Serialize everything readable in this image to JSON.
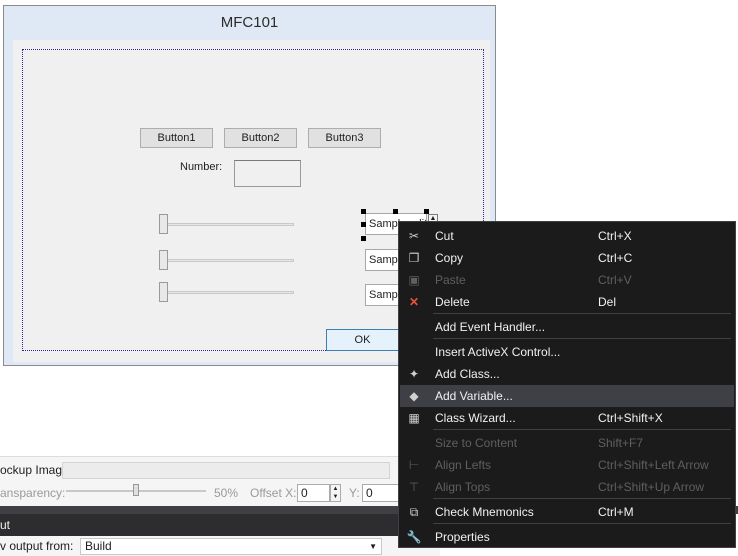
{
  "dialog": {
    "title": "MFC101",
    "buttons": [
      "Button1",
      "Button2",
      "Button3"
    ],
    "number_label": "Number:",
    "sample_edit_1": "Sample edit",
    "sample_edit_2": "Sample",
    "sample_edit_3": "Sample",
    "ok_label": "OK"
  },
  "properties_panel": {
    "mockup_label": "ockup Image:",
    "transparency_label": "ansparency:",
    "opacity_percent": "50%",
    "offset_x_label": "Offset X:",
    "offset_x_value": "0",
    "offset_y_label": "Y:",
    "offset_y_value": "0"
  },
  "output_panel": {
    "title": "ut",
    "show_output_label": "v output from:",
    "show_output_value": "Build"
  },
  "context_menu": {
    "items": [
      {
        "label": "Cut",
        "shortcut": "Ctrl+X",
        "icon": "scissors-icon",
        "glyph": "✂",
        "enabled": true
      },
      {
        "label": "Copy",
        "shortcut": "Ctrl+C",
        "icon": "copy-icon",
        "glyph": "❐",
        "enabled": true
      },
      {
        "label": "Paste",
        "shortcut": "Ctrl+V",
        "icon": "paste-icon",
        "glyph": "▣",
        "enabled": false
      },
      {
        "label": "Delete",
        "shortcut": "Del",
        "icon": "delete-icon",
        "glyph": "✕",
        "enabled": true
      },
      {
        "label": "Add Event Handler...",
        "shortcut": "",
        "icon": "",
        "glyph": "",
        "enabled": true
      },
      {
        "label": "Insert ActiveX Control...",
        "shortcut": "",
        "icon": "",
        "glyph": "",
        "enabled": true
      },
      {
        "label": "Add Class...",
        "shortcut": "",
        "icon": "add-class-icon",
        "glyph": "✦",
        "enabled": true
      },
      {
        "label": "Add Variable...",
        "shortcut": "",
        "icon": "add-variable-icon",
        "glyph": "◆",
        "enabled": true
      },
      {
        "label": "Class Wizard...",
        "shortcut": "Ctrl+Shift+X",
        "icon": "class-wizard-icon",
        "glyph": "▦",
        "enabled": true
      },
      {
        "label": "Size to Content",
        "shortcut": "Shift+F7",
        "icon": "",
        "glyph": "",
        "enabled": false
      },
      {
        "label": "Align Lefts",
        "shortcut": "Ctrl+Shift+Left Arrow",
        "icon": "align-lefts-icon",
        "glyph": "⊢",
        "enabled": false
      },
      {
        "label": "Align Tops",
        "shortcut": "Ctrl+Shift+Up Arrow",
        "icon": "align-tops-icon",
        "glyph": "⊤",
        "enabled": false
      },
      {
        "label": "Check Mnemonics",
        "shortcut": "Ctrl+M",
        "icon": "check-mnemonics-icon",
        "glyph": "⧉",
        "enabled": true
      },
      {
        "label": "Properties",
        "shortcut": "",
        "icon": "wrench-icon",
        "glyph": "🔧",
        "enabled": true
      }
    ],
    "highlighted": "Add Variable...",
    "delete_icon_color": "#e8533e"
  }
}
